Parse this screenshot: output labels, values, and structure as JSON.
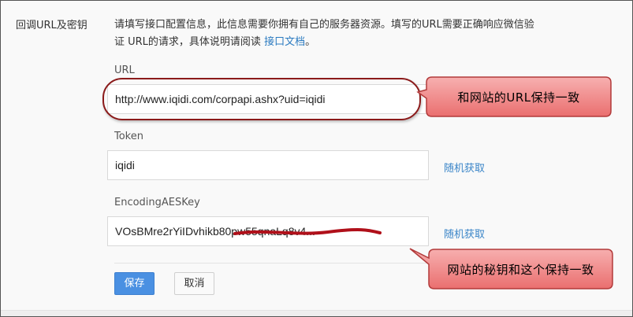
{
  "section": {
    "label": "回调URL及密钥",
    "desc_line1": "请填写接口配置信息，此信息需要你拥有自己的服务器资源。填写的URL需要正确响应微信验",
    "desc_line2": "证 URL的请求，具体说明请阅读 ",
    "doc_link": "接口文档",
    "desc_end": "。"
  },
  "fields": {
    "url": {
      "label": "URL",
      "value": "http://www.iqidi.com/corpapi.ashx?uid=iqidi"
    },
    "token": {
      "label": "Token",
      "value": "iqidi",
      "link": "随机获取"
    },
    "aes": {
      "label": "EncodingAESKey",
      "value": "VOsBMre2rYiIDvhikb80pw55qnaLq8v4...",
      "link": "随机获取"
    }
  },
  "buttons": {
    "save": "保存",
    "cancel": "取消"
  },
  "annotations": {
    "url_note": "和网站的URL保持一致",
    "key_note": "网站的秘钥和这个保持一致",
    "accent_color": "#8b1a1a",
    "bubble_color": "#f08a8a"
  }
}
